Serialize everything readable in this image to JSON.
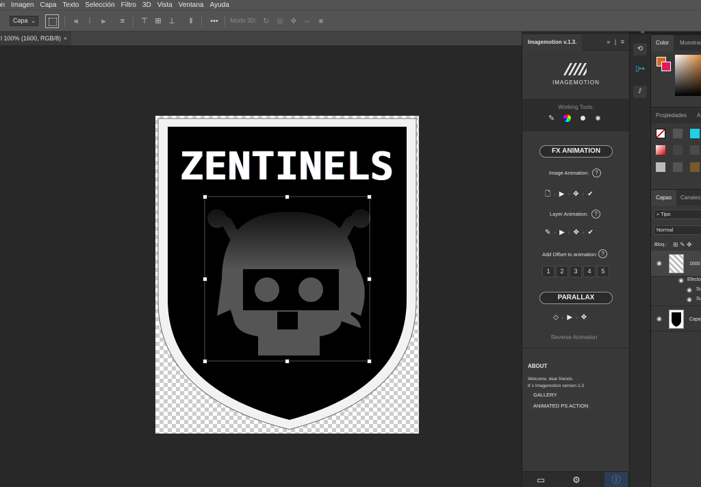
{
  "menu": {
    "items": [
      "ón",
      "Imagen",
      "Capa",
      "Texto",
      "Selección",
      "Filtro",
      "3D",
      "Vista",
      "Ventana",
      "Ayuda"
    ]
  },
  "options_bar": {
    "mode_select": "Capa",
    "more": "•••",
    "mode3d_label": "Modo 3D:"
  },
  "document": {
    "tab_label": "l 100% (1600, RGB/8)",
    "tab_close": "×",
    "shield_title": "ZENTINELS"
  },
  "imagemotion": {
    "panel_title": "Imagemotion v.1.3.",
    "header_icons": "»  |  ≡",
    "brand": "IMAGEMOTION",
    "working_tools_label": "Working Tools:",
    "fx_animation": "FX ANIMATION",
    "image_animation_label": "Image Animation:",
    "layer_animation_label": "Layer Animation:",
    "offset_label": "Add Offset to animation:",
    "help": "?",
    "offset_values": [
      "1",
      "2",
      "3",
      "4",
      "5"
    ],
    "parallax": "PARALLAX",
    "reverse_animation": "Reverse Animation",
    "about_heading": "ABOUT",
    "about_line1": "Welcome, dear friends.",
    "about_line2": "It´s Imagemotion version 1.3",
    "gallery": "GALLERY",
    "animated_action": "ANIMATED PS ACTION"
  },
  "right_panels": {
    "color_tab": "Color",
    "swatches_tab": "Muestras",
    "properties_tab": "Propiedades",
    "adjust_tab": "A",
    "layers_tab": "Capas",
    "channels_tab": "Canales",
    "filter_kind": "Tipo",
    "blend_mode": "Normal",
    "lock_label": "Bloq.:",
    "layers": [
      {
        "name": "1600"
      },
      {
        "name": "Efecto"
      },
      {
        "name": "Su"
      },
      {
        "name": "Su"
      },
      {
        "name": "Capa"
      }
    ]
  },
  "colors": {
    "foreground": "#d2691e",
    "background": "#e3175e",
    "accent": "#2ec7e8"
  }
}
